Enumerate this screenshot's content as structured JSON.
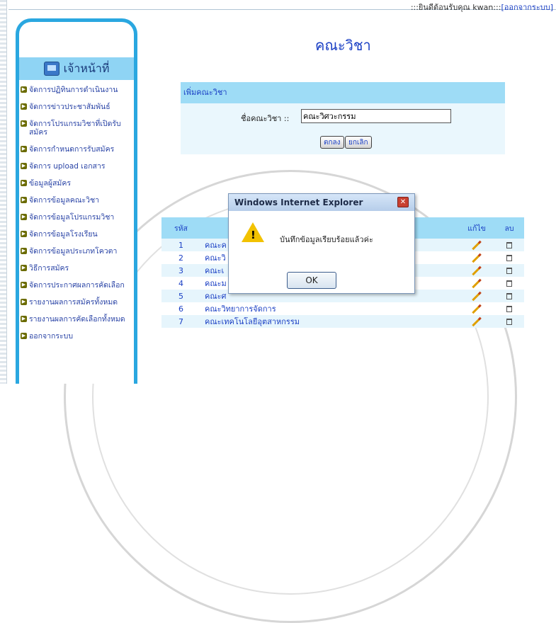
{
  "topbar": {
    "welcome_text": ":::ยินดีต้อนรับคุณ kwan:::",
    "logout_link": "[ออกจากระบบ]"
  },
  "sidebar": {
    "title": "เจ้าหน้าที่",
    "icon": "computer-icon",
    "items": [
      {
        "label": "จัดการปฏิทินการดำเนินงาน"
      },
      {
        "label": "จัดการข่าวประชาสัมพันธ์"
      },
      {
        "label": "จัดการโปรแกรมวิชาที่เปิดรับสมัคร"
      },
      {
        "label": "จัดการกำหนดการรับสมัคร"
      },
      {
        "label": "จัดการ upload เอกสาร"
      },
      {
        "label": "ข้อมูลผู้สมัคร"
      },
      {
        "label": "จัดการข้อมูลคณะวิชา"
      },
      {
        "label": "จัดการข้อมูลโปรแกรมวิชา"
      },
      {
        "label": "จัดการข้อมูลโรงเรียน"
      },
      {
        "label": "จัดการข้อมูลประเภทโควตา"
      },
      {
        "label": "วิธีการสมัคร"
      },
      {
        "label": "จัดการประกาศผลการคัดเลือก"
      },
      {
        "label": "รายงานผลการสมัครทั้งหมด"
      },
      {
        "label": "รายงานผลการคัดเลือกทั้งหมด"
      },
      {
        "label": "ออกจากระบบ"
      }
    ]
  },
  "main": {
    "page_title": "คณะวิชา",
    "form": {
      "header": "เพิ่มคณะวิชา",
      "field_label": "ชื่อคณะวิชา ::",
      "field_value": "คณะวิศวะกรรม",
      "submit_label": "ตกลง",
      "cancel_label": "ยกเลิก"
    },
    "table": {
      "headers": {
        "id": "รหัส",
        "name": "",
        "edit": "แก้ไข",
        "delete": "ลบ"
      },
      "rows": [
        {
          "id": "1",
          "name": "คณะค"
        },
        {
          "id": "2",
          "name": "คณะวิ"
        },
        {
          "id": "3",
          "name": "คณะเ"
        },
        {
          "id": "4",
          "name": "คณะม"
        },
        {
          "id": "5",
          "name": "คณะศ"
        },
        {
          "id": "6",
          "name": "คณะวิทยาการจัดการ"
        },
        {
          "id": "7",
          "name": "คณะเทคโนโลยีอุตสาหกรรม"
        }
      ]
    }
  },
  "dialog": {
    "title": "Windows Internet Explorer",
    "close": "✕",
    "message": "บันทึกข้อมูลเรียบร้อยแล้วค่ะ",
    "ok_label": "OK",
    "icon": "warning-icon"
  }
}
